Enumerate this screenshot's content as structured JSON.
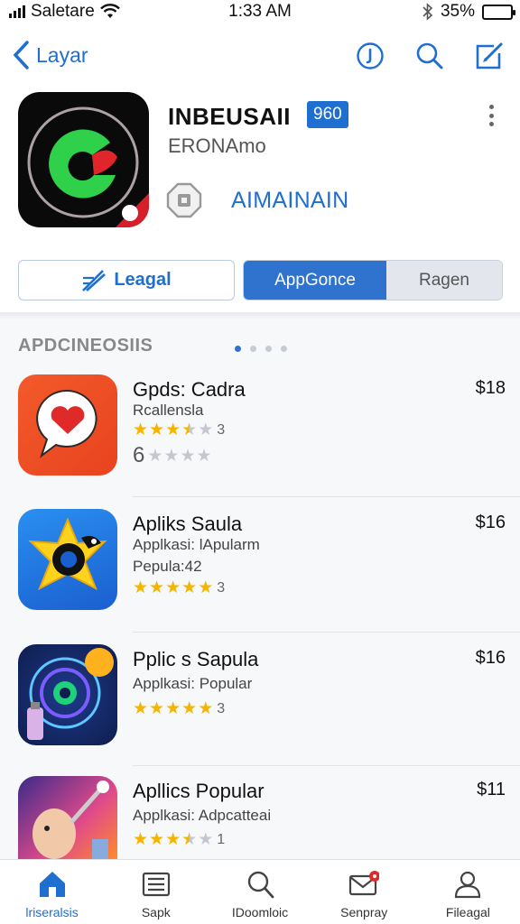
{
  "status_bar": {
    "carrier": "Saletare",
    "time": "1:33 AM",
    "battery": "35%"
  },
  "nav": {
    "back_label": "Layar",
    "icons": [
      "info-icon",
      "search-icon",
      "edit-icon"
    ]
  },
  "header": {
    "title": "INBEUSAII",
    "badge": "960",
    "subtitle": "ERONAmo",
    "link": "AIMAINAIN",
    "legal_button": "Leagal",
    "segments": [
      "AppGonce",
      "Ragen"
    ]
  },
  "section": {
    "title": "APDCINEOSIIS",
    "page_count": 4,
    "active_page": 1
  },
  "apps": [
    {
      "name": "Gpds: Cadra",
      "price": "$18",
      "line1": "Rcallensla",
      "rating": 3.5,
      "rating_count": "3",
      "line2_prefix": "6",
      "rating2": 0
    },
    {
      "name": "Apliks Saula",
      "price": "$16",
      "line1": "Applkasi: lApularm",
      "line2": "Pepula:42",
      "rating": 5,
      "rating_count": "3"
    },
    {
      "name": "Pplic s Sapula",
      "price": "$16",
      "line1": "Applkasi: Popular",
      "rating": 5,
      "rating_count": "3"
    },
    {
      "name": "Apllics Popular",
      "price": "$11",
      "line1": "Applkasi: Adpcatteai",
      "rating": 3.5,
      "rating_count": "1"
    }
  ],
  "tabs": [
    {
      "label": "lriseralsis",
      "icon": "home-icon",
      "active": true
    },
    {
      "label": "Sapk",
      "icon": "list-icon",
      "active": false
    },
    {
      "label": "IDoomloic",
      "icon": "search-icon",
      "active": false
    },
    {
      "label": "Senpray",
      "icon": "mail-icon",
      "active": false
    },
    {
      "label": "Fileagal",
      "icon": "profile-icon",
      "active": false
    }
  ],
  "colors": {
    "accent": "#1f6fd1",
    "star": "#f4b400",
    "battery": "#2fbf3a"
  }
}
